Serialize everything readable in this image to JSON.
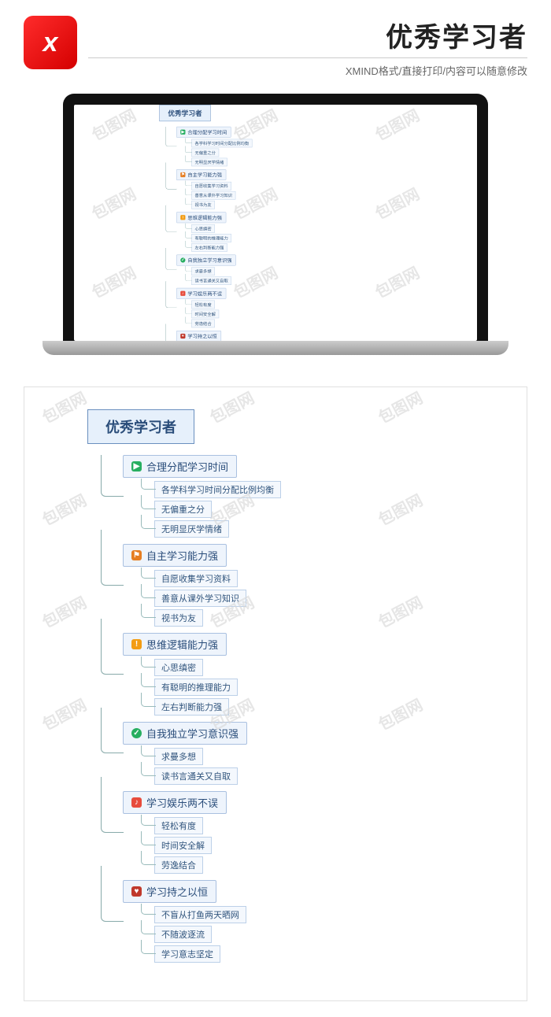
{
  "watermark_text": "包图网",
  "header": {
    "title": "优秀学习者",
    "subtitle": "XMIND格式/直接打印/内容可以随意修改",
    "app_glyph": "x"
  },
  "mindmap": {
    "root": "优秀学习者",
    "branches": [
      {
        "icon": "play",
        "label": "合理分配学习时间",
        "children": [
          "各学科学习时间分配比例均衡",
          "无偏重之分",
          "无明显厌学情绪"
        ]
      },
      {
        "icon": "flag",
        "label": "自主学习能力强",
        "children": [
          "自愿收集学习资料",
          "善意从课外学习知识",
          "视书为友"
        ]
      },
      {
        "icon": "info",
        "label": "思维逻辑能力强",
        "children": [
          "心思缜密",
          "有聪明的推理能力",
          "左右判断能力强"
        ]
      },
      {
        "icon": "check",
        "label": "自我独立学习意识强",
        "children": [
          "求曼多想",
          "读书言通关又自取"
        ]
      },
      {
        "icon": "music",
        "label": "学习娱乐两不误",
        "children": [
          "轻松有度",
          "时间安全解",
          "劳逸结合"
        ]
      },
      {
        "icon": "heart",
        "label": "学习持之以恒",
        "children": [
          "不盲从打鱼两天晒网",
          "不随波逐流",
          "学习意志坚定"
        ]
      }
    ]
  }
}
